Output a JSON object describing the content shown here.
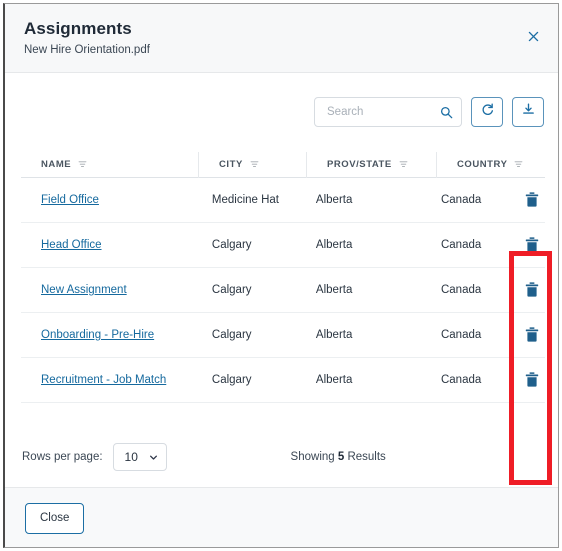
{
  "dialog": {
    "title": "Assignments",
    "subtitle": "New Hire Orientation.pdf",
    "close_icon": "close-icon"
  },
  "toolbar": {
    "search_placeholder": "Search",
    "search_value": "",
    "search_icon": "search-icon",
    "refresh_icon": "refresh-icon",
    "download_icon": "download-icon"
  },
  "table": {
    "columns": [
      {
        "label": "NAME",
        "filter_icon": "filter-icon"
      },
      {
        "label": "CITY",
        "filter_icon": "filter-icon"
      },
      {
        "label": "PROV/STATE",
        "filter_icon": "filter-icon"
      },
      {
        "label": "COUNTRY",
        "filter_icon": "filter-icon"
      }
    ],
    "rows": [
      {
        "name": "Field Office",
        "city": "Medicine Hat",
        "prov": "Alberta",
        "country": "Canada",
        "delete_icon": "trash-icon"
      },
      {
        "name": "Head Office",
        "city": "Calgary",
        "prov": "Alberta",
        "country": "Canada",
        "delete_icon": "trash-icon"
      },
      {
        "name": "New Assignment",
        "city": "Calgary",
        "prov": "Alberta",
        "country": "Canada",
        "delete_icon": "trash-icon"
      },
      {
        "name": "Onboarding - Pre-Hire",
        "city": "Calgary",
        "prov": "Alberta",
        "country": "Canada",
        "delete_icon": "trash-icon"
      },
      {
        "name": "Recruitment - Job Match",
        "city": "Calgary",
        "prov": "Alberta",
        "country": "Canada",
        "delete_icon": "trash-icon"
      }
    ]
  },
  "pagination": {
    "rows_per_page_label": "Rows per page:",
    "rows_per_page_value": "10",
    "chevron_icon": "chevron-down-icon",
    "showing_prefix": "Showing ",
    "showing_count": "5",
    "showing_suffix": " Results"
  },
  "footer": {
    "close_label": "Close"
  },
  "annotation": {
    "color": "#ef1d26",
    "target": "delete-column"
  }
}
